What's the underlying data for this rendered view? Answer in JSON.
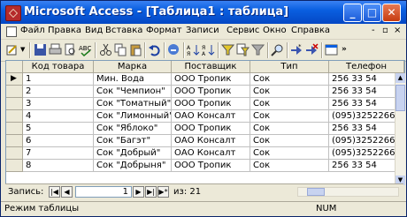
{
  "window": {
    "title": "Microsoft Access - [Таблица1 : таблица]",
    "minimize_glyph": "_",
    "maximize_glyph": "□",
    "close_glyph": "✕"
  },
  "menu": {
    "items": [
      "Файл",
      "Правка",
      "Вид",
      "Вставка",
      "Формат",
      "Записи",
      "Сервис",
      "Окно",
      "Справка"
    ],
    "controls": [
      "-",
      "▫",
      "×"
    ]
  },
  "table": {
    "columns": [
      "Код товара",
      "Марка",
      "Поставщик",
      "Тип",
      "Телефон"
    ],
    "rows": [
      [
        "1",
        "Мин. Вода",
        "ООО Тропик",
        "Сок",
        "256 33 54"
      ],
      [
        "2",
        "Сок \"Чемпион\"",
        "ООО Тропик",
        "Сок",
        "256 33 54"
      ],
      [
        "3",
        "Сок \"Томатный\"",
        "ООО Тропик",
        "Сок",
        "256 33 54"
      ],
      [
        "4",
        "Сок \"Лимонный\"",
        "ОАО Консалт",
        "Сок",
        "(095)3252266"
      ],
      [
        "5",
        "Сок \"Яблоко\"",
        "ООО Тропик",
        "Сок",
        "256 33 54"
      ],
      [
        "6",
        "Сок \"Багэт\"",
        "ОАО Консалт",
        "Сок",
        "(095)3252266"
      ],
      [
        "7",
        "Сок \"Добрый\"",
        "ОАО Консалт",
        "Сок",
        "(095)3252266"
      ],
      [
        "8",
        "Сок \"Добрыня\"",
        "ООО Тропик",
        "Сок",
        "256 33 54"
      ]
    ]
  },
  "navigation": {
    "label": "Запись:",
    "current": "1",
    "of_label": "из: 21"
  },
  "status": {
    "mode": "Режим таблицы",
    "num": "NUM"
  },
  "colors": {
    "titlebar": "#0a5fe0",
    "chrome": "#ece9d8",
    "grid_line": "#c0c0c0"
  }
}
